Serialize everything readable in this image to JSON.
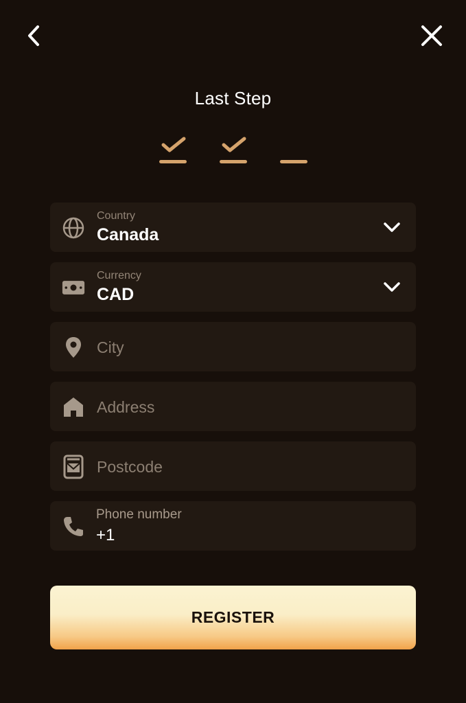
{
  "header": {
    "back_icon": "chevron-left-icon",
    "close_icon": "close-icon",
    "title": "Last Step"
  },
  "stepper": {
    "steps": [
      {
        "state": "done",
        "icon": "check-icon"
      },
      {
        "state": "done",
        "icon": "check-icon"
      },
      {
        "state": "current",
        "icon": ""
      }
    ],
    "accent_color": "#d5a36c"
  },
  "form": {
    "country": {
      "label": "Country",
      "value": "Canada",
      "icon": "globe-icon"
    },
    "currency": {
      "label": "Currency",
      "value": "CAD",
      "icon": "money-icon"
    },
    "city": {
      "placeholder": "City",
      "icon": "location-pin-icon"
    },
    "address": {
      "placeholder": "Address",
      "icon": "home-icon"
    },
    "postcode": {
      "placeholder": "Postcode",
      "icon": "mailbox-icon"
    },
    "phone": {
      "label": "Phone number",
      "value": "+1",
      "icon": "phone-icon"
    }
  },
  "register_label": "REGISTER",
  "colors": {
    "background": "#170f0a",
    "field_background": "#221912",
    "button_gradient_top": "#fbf3d2",
    "button_gradient_bottom": "#f1a24a"
  }
}
